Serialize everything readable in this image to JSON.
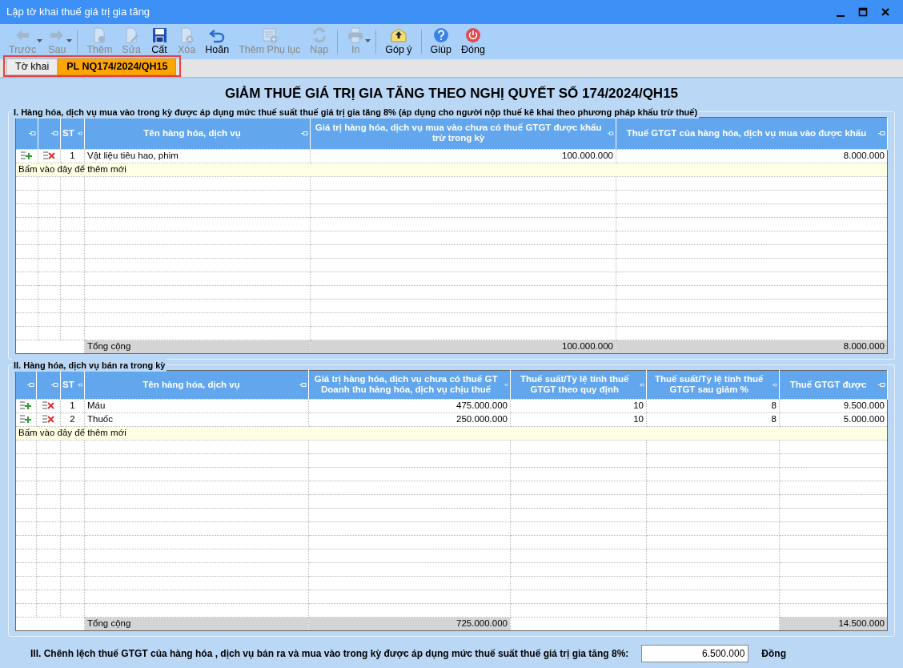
{
  "window": {
    "title": "Lập tờ khai thuế giá trị gia tăng"
  },
  "toolbar": [
    {
      "kind": "back",
      "label": "Trước",
      "disabled": true,
      "dropdown": true,
      "separator_before": false
    },
    {
      "kind": "forward",
      "label": "Sau",
      "disabled": true,
      "dropdown": true,
      "separator_before": false
    },
    {
      "kind": "new",
      "label": "Thêm",
      "disabled": true,
      "dropdown": false,
      "separator_before": true
    },
    {
      "kind": "edit",
      "label": "Sửa",
      "disabled": true,
      "dropdown": false,
      "separator_before": false
    },
    {
      "kind": "save",
      "label": "Cất",
      "disabled": false,
      "dropdown": false,
      "separator_before": false
    },
    {
      "kind": "delete",
      "label": "Xóa",
      "disabled": true,
      "dropdown": false,
      "separator_before": false
    },
    {
      "kind": "undo",
      "label": "Hoãn",
      "disabled": false,
      "dropdown": false,
      "separator_before": false
    },
    {
      "kind": "appendix",
      "label": "Thêm Phụ lục",
      "disabled": true,
      "dropdown": false,
      "separator_before": false
    },
    {
      "kind": "reload",
      "label": "Nạp",
      "disabled": true,
      "dropdown": false,
      "separator_before": false
    },
    {
      "kind": "print",
      "label": "In",
      "disabled": true,
      "dropdown": true,
      "separator_before": true
    },
    {
      "kind": "feedback",
      "label": "Góp ý",
      "disabled": false,
      "dropdown": false,
      "separator_before": true
    },
    {
      "kind": "help",
      "label": "Giúp",
      "disabled": false,
      "dropdown": false,
      "separator_before": true
    },
    {
      "kind": "close",
      "label": "Đóng",
      "disabled": false,
      "dropdown": false,
      "separator_before": false
    }
  ],
  "tabs": {
    "highlighted": true,
    "items": [
      {
        "label": "Tờ khai",
        "selected": false
      },
      {
        "label": "PL NQ174/2024/QH15",
        "selected": true
      }
    ]
  },
  "heading": "GIẢM THUẾ GIÁ TRỊ GIA TĂNG THEO NGHỊ QUYẾT SỐ 174/2024/QH15",
  "sections": [
    {
      "title": "I. Hàng hóa, dịch vụ mua vào trong kỳ được áp dụng mức thuế suất thuế giá trị gia tăng 8% (áp dụng cho người nộp thuế kê khai theo phương pháp khấu trừ thuế)",
      "columns": [
        "ST",
        "Tên hàng hóa, dịch vụ",
        "Giá trị hàng hóa, dịch vụ mua vào chưa có thuế GTGT được khấu trừ trong kỳ",
        "Thuế GTGT của hàng hóa, dịch vụ mua vào được khấu"
      ],
      "rows": [
        [
          "1",
          "Vật liệu tiêu hao, phim",
          "100.000.000",
          "8.000.000"
        ]
      ],
      "add_row_hint": "Bấm vào đây để thêm mới",
      "total": [
        {
          "kind": "text",
          "text": "Tổng cộng"
        },
        {
          "kind": "text",
          "text": "100.000.000"
        },
        {
          "kind": "text",
          "text": "8.000.000"
        }
      ]
    },
    {
      "title": "II. Hàng hóa, dịch vụ bán ra trong kỳ",
      "columns": [
        "ST",
        "Tên hàng hóa, dịch vụ",
        "Giá trị hàng hóa, dịch vụ chưa có thuế GT Doanh thu hàng hóa, dịch vụ chịu thuế",
        "Thuế suất/Tỷ lệ tính thuế GTGT theo quy định",
        "Thuế suất/Tỷ lệ tính thuế GTGT sau giảm %",
        "Thuế GTGT được"
      ],
      "rows": [
        [
          "1",
          "Máu",
          "475.000.000",
          "10",
          "8",
          "9.500.000"
        ],
        [
          "2",
          "Thuốc",
          "250.000.000",
          "10",
          "8",
          "5.000.000"
        ]
      ],
      "add_row_hint": "Bấm vào đây để thêm mới",
      "total": [
        {
          "kind": "text",
          "text": "Tổng cộng"
        },
        {
          "kind": "text",
          "text": "725.000.000"
        },
        {
          "kind": "blank"
        },
        {
          "kind": "blank"
        },
        {
          "kind": "text",
          "text": "14.500.000"
        }
      ]
    }
  ],
  "difference": {
    "label": "III. Chênh lệch thuế GTGT của hàng hóa , dịch vụ bán ra và mua vào trong kỳ được áp dụng mức thuế suất thuế giá trị gia tăng 8%:",
    "value": "6.500.000",
    "unit": "Đồng"
  }
}
